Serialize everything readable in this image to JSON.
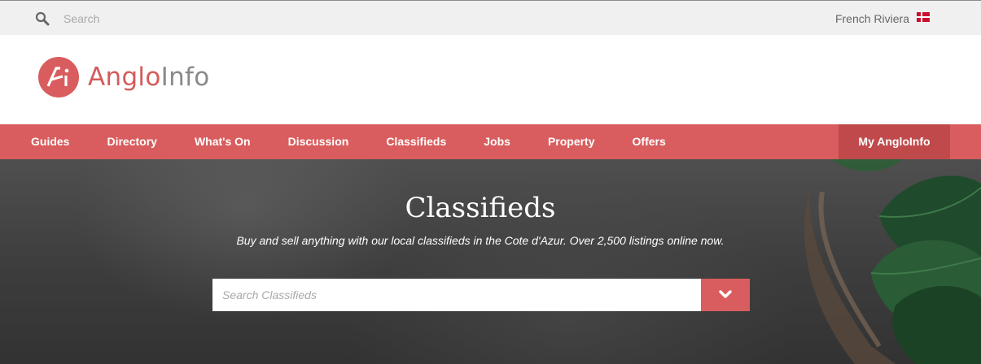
{
  "topbar": {
    "search_placeholder": "Search",
    "region": "French Riviera"
  },
  "header": {
    "logo_text_part1": "Anglo",
    "logo_text_part2": "Info"
  },
  "nav": {
    "items": [
      {
        "label": "Guides"
      },
      {
        "label": "Directory"
      },
      {
        "label": "What's On"
      },
      {
        "label": "Discussion"
      },
      {
        "label": "Classifieds"
      },
      {
        "label": "Jobs"
      },
      {
        "label": "Property"
      },
      {
        "label": "Offers"
      }
    ],
    "my_account": "My AngloInfo"
  },
  "hero": {
    "title": "Classifieds",
    "subtitle": "Buy and sell anything with our local classifieds in the Cote d'Azur. Over 2,500 listings online now.",
    "search_placeholder": "Search Classifieds"
  },
  "colors": {
    "brand": "#d95d5e",
    "brand_dark": "#c04a4b",
    "topbar_bg": "#f0f0f0"
  },
  "icons": {
    "search": "search-icon",
    "flag": "denmark-flag-icon",
    "dropdown": "chevron-down-icon",
    "logo": "angloinfo-logo-icon"
  }
}
